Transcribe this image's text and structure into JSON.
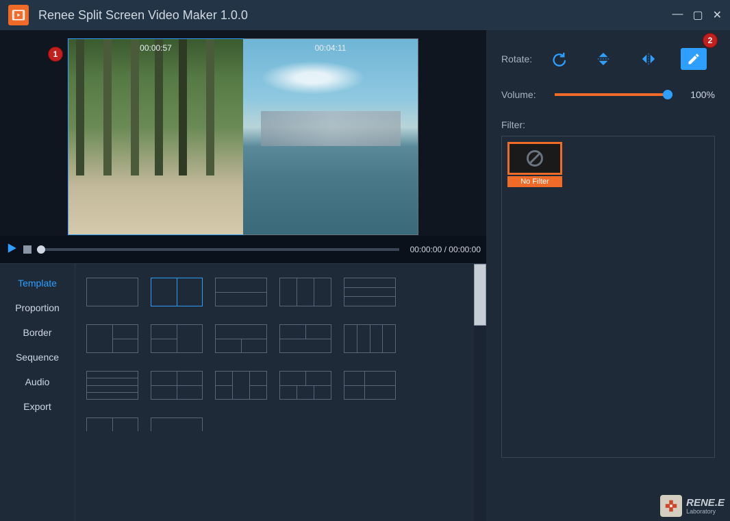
{
  "app": {
    "title": "Renee Split Screen Video Maker 1.0.0"
  },
  "annotations": {
    "one": "1",
    "two": "2"
  },
  "preview": {
    "clip1_time": "00:00:57",
    "clip2_time": "00:04:11"
  },
  "playback": {
    "time": "00:00:00 / 00:00:00"
  },
  "tabs": {
    "template": "Template",
    "proportion": "Proportion",
    "border": "Border",
    "sequence": "Sequence",
    "audio": "Audio",
    "export": "Export"
  },
  "controls": {
    "rotate_label": "Rotate:",
    "volume_label": "Volume:",
    "volume_value": "100%",
    "filter_label": "Filter:"
  },
  "filters": {
    "none": "No Filter"
  },
  "brand": {
    "name": "RENE.E",
    "sub": "Laboratory"
  }
}
